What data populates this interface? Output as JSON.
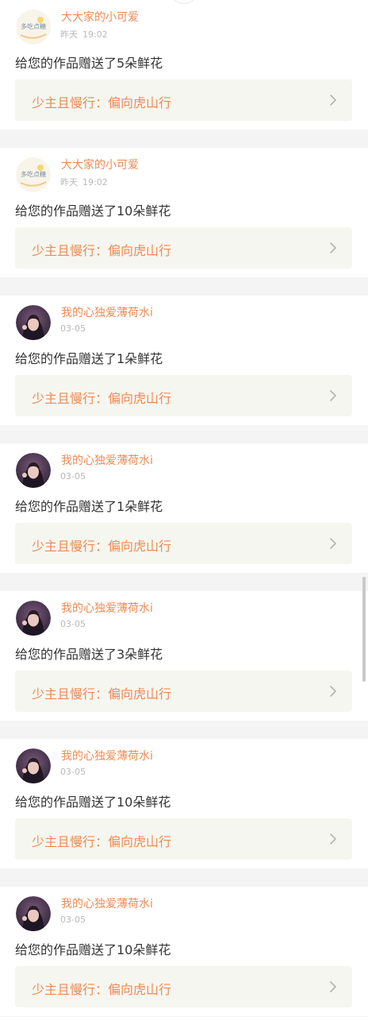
{
  "colors": {
    "accent": "#ef8a52",
    "card_bg": "#ffffff",
    "link_bg": "#f6f6f0",
    "page_bg": "#f4f4f4",
    "text": "#333333",
    "muted": "#b8b8b8"
  },
  "items": [
    {
      "user": "大大家的小可爱",
      "date": "昨天",
      "time": "19:02",
      "message": "给您的作品赠送了5朵鲜花",
      "work_title": "少主且慢行：偏向虎山行",
      "avatar": "logo-avatar",
      "avatar_text": "多吃点糖"
    },
    {
      "user": "大大家的小可爱",
      "date": "昨天",
      "time": "19:02",
      "message": "给您的作品赠送了10朵鲜花",
      "work_title": "少主且慢行：偏向虎山行",
      "avatar": "logo-avatar",
      "avatar_text": "多吃点糖"
    },
    {
      "user": "我的心独爱薄荷水i",
      "date": "",
      "time": "03-05",
      "message": "给您的作品赠送了1朵鲜花",
      "work_title": "少主且慢行：偏向虎山行",
      "avatar": "photo-avatar",
      "avatar_text": ""
    },
    {
      "user": "我的心独爱薄荷水i",
      "date": "",
      "time": "03-05",
      "message": "给您的作品赠送了1朵鲜花",
      "work_title": "少主且慢行：偏向虎山行",
      "avatar": "photo-avatar",
      "avatar_text": ""
    },
    {
      "user": "我的心独爱薄荷水i",
      "date": "",
      "time": "03-05",
      "message": "给您的作品赠送了3朵鲜花",
      "work_title": "少主且慢行：偏向虎山行",
      "avatar": "photo-avatar",
      "avatar_text": ""
    },
    {
      "user": "我的心独爱薄荷水i",
      "date": "",
      "time": "03-05",
      "message": "给您的作品赠送了10朵鲜花",
      "work_title": "少主且慢行：偏向虎山行",
      "avatar": "photo-avatar",
      "avatar_text": ""
    },
    {
      "user": "我的心独爱薄荷水i",
      "date": "",
      "time": "03-05",
      "message": "给您的作品赠送了10朵鲜花",
      "work_title": "少主且慢行：偏向虎山行",
      "avatar": "photo-avatar",
      "avatar_text": ""
    }
  ],
  "icons": {
    "chevron": "chevron-right-icon"
  }
}
